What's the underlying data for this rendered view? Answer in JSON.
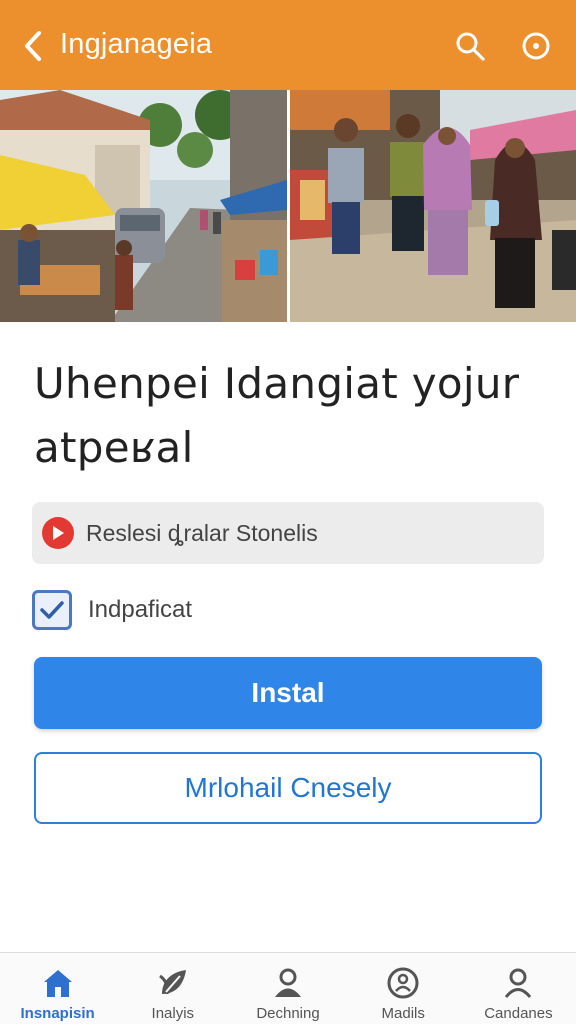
{
  "colors": {
    "header": "#ec8f2d",
    "primary": "#2f86e8",
    "accent_red": "#e23a32",
    "active_nav": "#2f6fd0"
  },
  "header": {
    "title": "Ingjanageia",
    "back_icon": "chevron-left-icon",
    "search_icon": "search-icon",
    "more_icon": "more-circle-icon"
  },
  "hero": {
    "left_photo": "street-market-photo",
    "right_photo": "people-walking-photo"
  },
  "main": {
    "headline": "Uhenpei Idangiat yojur atpeʁal",
    "info_chip": {
      "icon": "play-circle-icon",
      "text": "Reslesi ȡralar Stonelis"
    },
    "checkbox": {
      "checked": true,
      "label": "Indpaficat"
    },
    "primary_button": "Instal",
    "secondary_button": "Mrlohail Cnesely"
  },
  "bottom_nav": [
    {
      "label": "Insnapisin",
      "icon": "home-icon",
      "active": true
    },
    {
      "label": "Inalyis",
      "icon": "leaf-icon",
      "active": false
    },
    {
      "label": "Dechning",
      "icon": "person-icon",
      "active": false
    },
    {
      "label": "Madils",
      "icon": "badge-icon",
      "active": false
    },
    {
      "label": "Candanes",
      "icon": "profile-icon",
      "active": false
    }
  ]
}
